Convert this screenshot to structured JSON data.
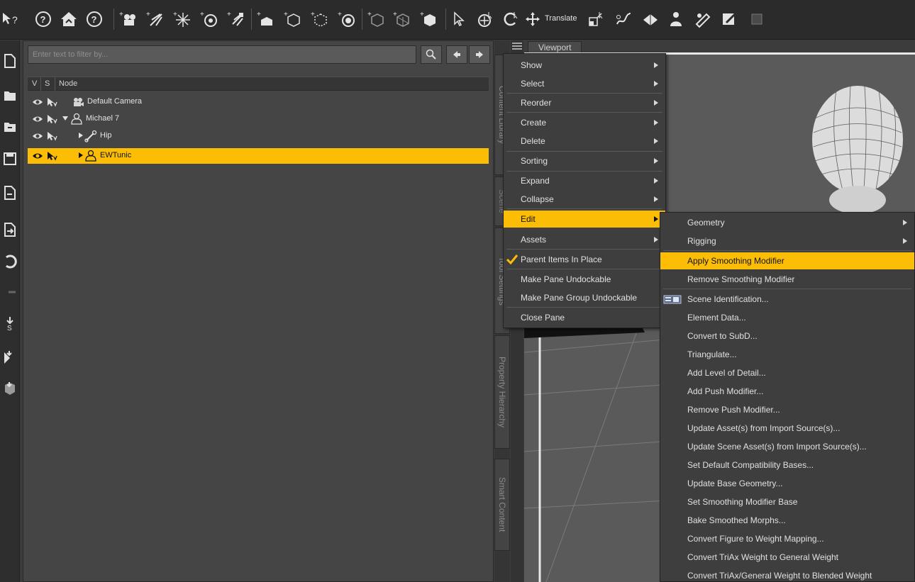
{
  "toolbar": {
    "translate_label": "Translate"
  },
  "scene": {
    "filter_placeholder": "Enter text to filter by...",
    "columns": {
      "v": "V",
      "s": "S",
      "node": "Node"
    },
    "nodes": [
      {
        "label": "Default Camera"
      },
      {
        "label": "Michael 7"
      },
      {
        "label": "Hip"
      },
      {
        "label": "EWTunic"
      }
    ]
  },
  "side_tabs": {
    "content_library": "Content Library",
    "scene": "Scene",
    "tool_settings": "Tool Settings",
    "property_hierarchy": "Property Hierarchy",
    "smart_content": "Smart Content"
  },
  "viewport": {
    "tab_label": "Viewport"
  },
  "context_menu": {
    "items": [
      {
        "label": "Show",
        "submenu": true
      },
      {
        "label": "Select",
        "submenu": true
      },
      {
        "label": "Reorder",
        "submenu": true
      },
      {
        "label": "Create",
        "submenu": true
      },
      {
        "label": "Delete",
        "submenu": true
      },
      {
        "label": "Sorting",
        "submenu": true
      },
      {
        "label": "Expand",
        "submenu": true
      },
      {
        "label": "Collapse",
        "submenu": true
      },
      {
        "label": "Edit",
        "submenu": true,
        "highlighted": true
      },
      {
        "label": "Assets",
        "submenu": true
      },
      {
        "label": "Parent Items In Place",
        "checked": true
      },
      {
        "label": "Make Pane Undockable"
      },
      {
        "label": "Make Pane Group Undockable"
      },
      {
        "label": "Close Pane"
      }
    ]
  },
  "edit_submenu": {
    "items": [
      {
        "label": "Geometry",
        "submenu": true
      },
      {
        "label": "Rigging",
        "submenu": true
      },
      {
        "label": "Apply Smoothing Modifier",
        "highlighted": true
      },
      {
        "label": "Remove Smoothing Modifier"
      },
      {
        "label": "Scene Identification..."
      },
      {
        "label": "Element Data..."
      },
      {
        "label": "Convert to SubD..."
      },
      {
        "label": "Triangulate..."
      },
      {
        "label": "Add Level of Detail..."
      },
      {
        "label": "Add Push Modifier..."
      },
      {
        "label": "Remove Push Modifier..."
      },
      {
        "label": "Update Asset(s) from Import Source(s)..."
      },
      {
        "label": "Update Scene Asset(s) from Import Source(s)..."
      },
      {
        "label": "Set Default Compatibility Bases..."
      },
      {
        "label": "Update Base Geometry..."
      },
      {
        "label": "Set Smoothing Modifier Base"
      },
      {
        "label": "Bake Smoothed Morphs..."
      },
      {
        "label": "Convert Figure to Weight Mapping..."
      },
      {
        "label": "Convert TriAx Weight to General Weight"
      },
      {
        "label": "Convert TriAx/General Weight to Blended Weight"
      }
    ]
  },
  "colors": {
    "highlight": "#fbbd05",
    "panel_bg": "#454545",
    "menu_bg": "#3e3e3e",
    "toolbar_bg": "#2b2b2b"
  }
}
